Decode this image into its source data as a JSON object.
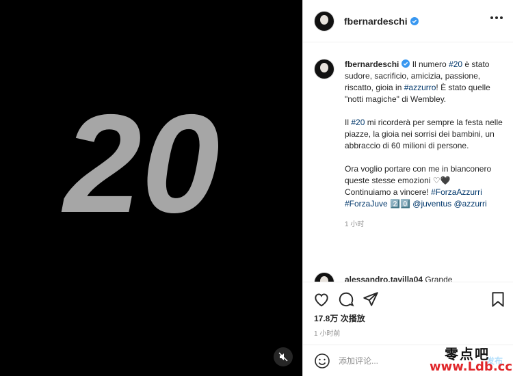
{
  "media": {
    "number_text": "20",
    "background": "#000000",
    "number_color": "#a6a6a6"
  },
  "header": {
    "username": "fbernardeschi"
  },
  "caption": {
    "username": "fbernardeschi",
    "p1_a": "Il numero ",
    "p1_tag1": "#20",
    "p1_b": " è stato sudore, sacrificio, amicizia, passione, riscatto, gioia in ",
    "p1_tag2": "#azzurro",
    "p1_c": "! È stato quelle \"notti magiche\" di Wembley.",
    "p2_a": "Il ",
    "p2_tag": "#20",
    "p2_b": " mi ricorderà per sempre la festa nelle piazze, la gioia nei sorrisi dei bambini, un abbraccio di 60 milioni di persone.",
    "p3": "Ora voglio portare con me in bianconero queste stesse emozioni ",
    "p3_hearts": "♡🖤",
    "p4_a": "Continuiamo a vincere! ",
    "p4_tag1": "#ForzaAzzurri",
    "p4_tag2": "#ForzaJuve",
    "p4_digits": " 2️⃣0️⃣ ",
    "p4_mention1": "@juventus",
    "p4_mention2": "@azzurri",
    "time": "1 小时"
  },
  "comment": {
    "username": "alessandro.tavilla04",
    "text": "Grande"
  },
  "stats": {
    "views": "17.8万 次播放",
    "posted": "1 小时前"
  },
  "add_comment": {
    "placeholder": "添加评论...",
    "post_label": "发布"
  },
  "watermark": {
    "cn": "零点吧",
    "url": "www.Ldb.cc"
  }
}
